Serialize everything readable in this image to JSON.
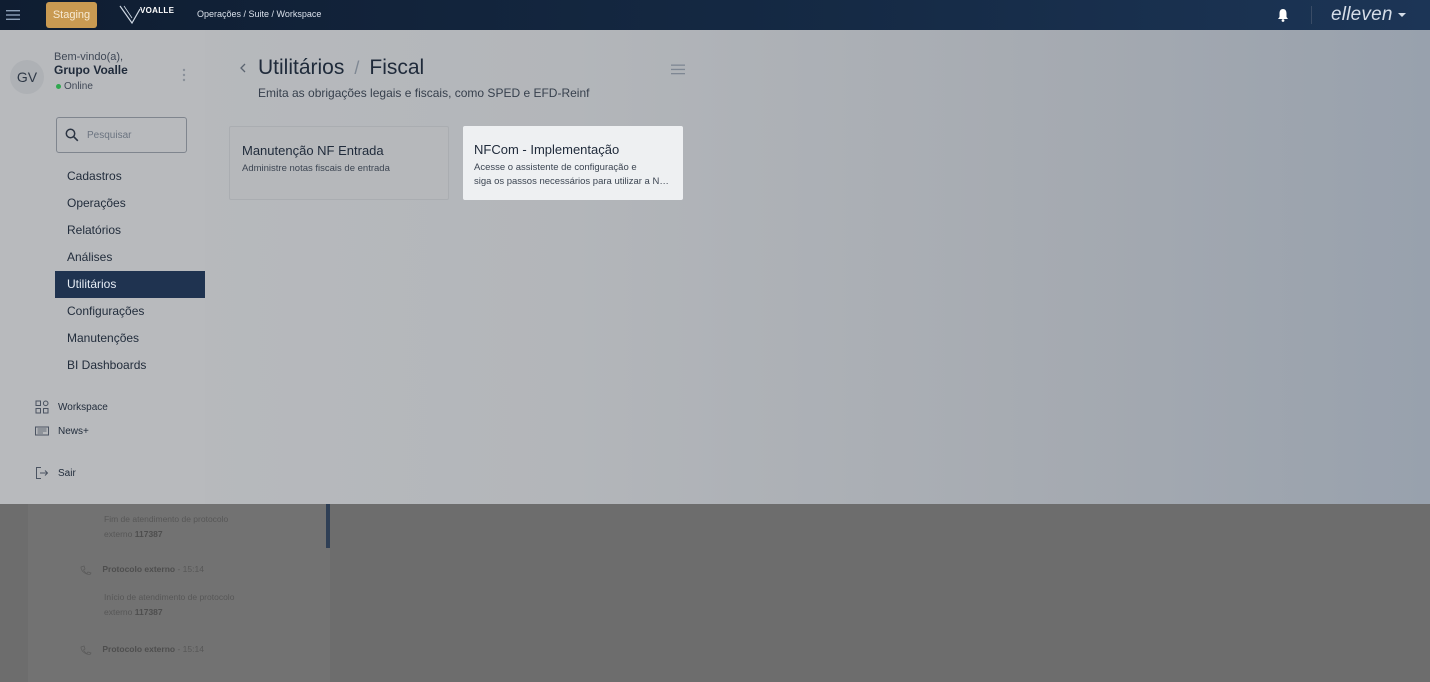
{
  "topbar": {
    "env_badge": "Staging",
    "logo_text": "VOALLE",
    "breadcrumb": "Operações / Suite / Workspace",
    "brand": "elleven"
  },
  "sidebar": {
    "avatar_initials": "GV",
    "welcome": "Bem-vindo(a),",
    "company": "Grupo Voalle",
    "status": "Online",
    "search_placeholder": "Pesquisar",
    "nav": [
      {
        "label": "Cadastros",
        "active": false
      },
      {
        "label": "Operações",
        "active": false
      },
      {
        "label": "Relatórios",
        "active": false
      },
      {
        "label": "Análises",
        "active": false
      },
      {
        "label": "Utilitários",
        "active": true
      },
      {
        "label": "Configurações",
        "active": false
      },
      {
        "label": "Manutenções",
        "active": false
      },
      {
        "label": "BI Dashboards",
        "active": false
      }
    ],
    "workspace": "Workspace",
    "news": "News+",
    "logout": "Sair"
  },
  "main": {
    "title": "Utilitários",
    "title_sep": "/",
    "title_sub": "Fiscal",
    "subtitle": "Emita as obrigações legais e fiscais, como SPED e EFD-Reinf",
    "cards": [
      {
        "title": "Manutenção NF Entrada",
        "desc": "Administre notas fiscais de entrada",
        "desc2": ""
      },
      {
        "title": "NFCom - Implementação",
        "desc": "Acesse o assistente de configuração e",
        "desc2": "siga os passos necessários para utilizar a NFCom"
      }
    ]
  },
  "background_feed": {
    "entry1_text": "Fim de atendimento de protocolo",
    "entry1_text2": "externo",
    "entry1_id": "117387",
    "entry2_label": "Protocolo externo",
    "entry2_time": "- 15:14",
    "entry3_text": "Início de atendimento de protocolo",
    "entry3_text2": "externo",
    "entry3_id": "117387",
    "entry4_label": "Protocolo externo",
    "entry4_time": "- 15:14"
  }
}
